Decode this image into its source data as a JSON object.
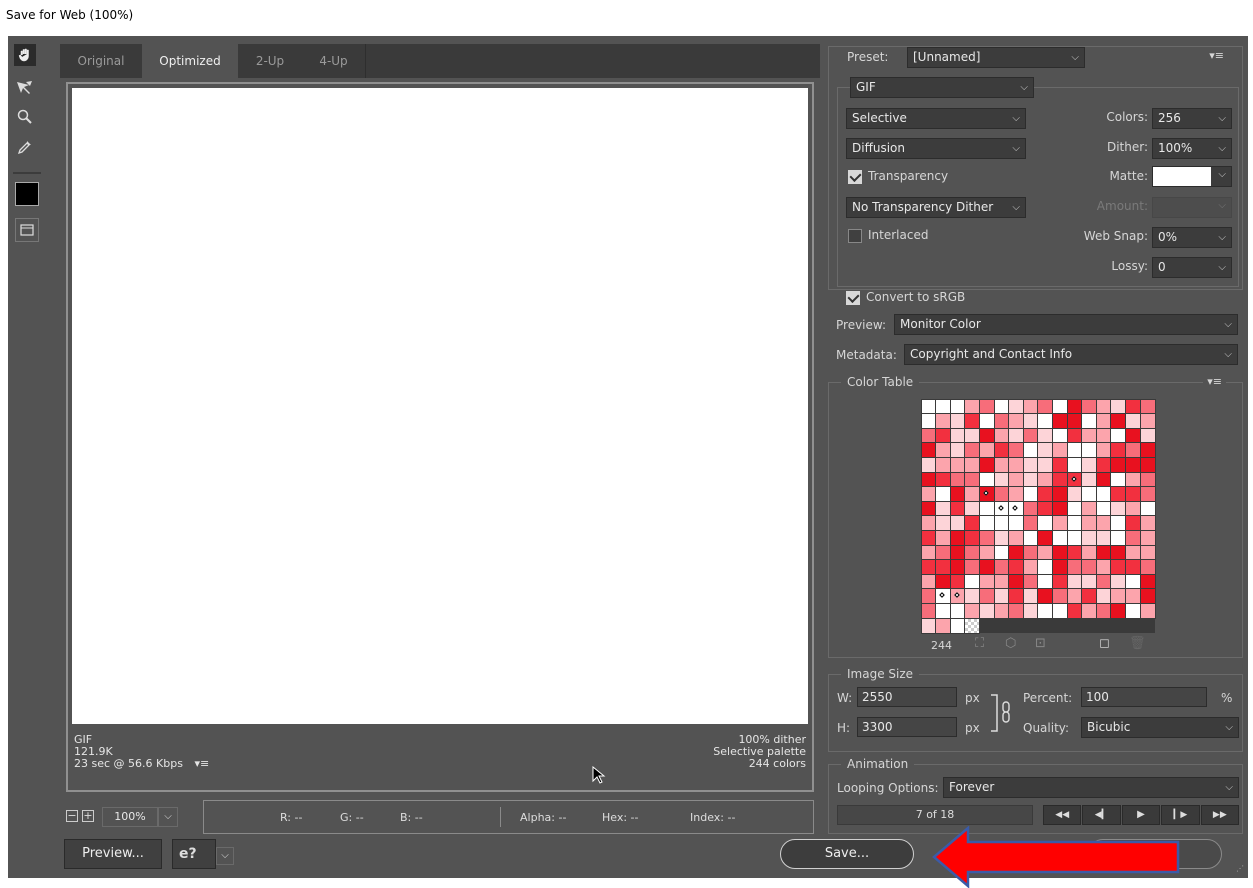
{
  "window_title": "Save for Web (100%)",
  "tabs": [
    "Original",
    "Optimized",
    "2-Up",
    "4-Up"
  ],
  "preview_info": {
    "format": "GIF",
    "size": "121.9K",
    "speed": "23 sec @ 56.6 Kbps",
    "dither": "100% dither",
    "palette": "Selective palette",
    "colors": "244 colors"
  },
  "status_bar": {
    "zoom": "100%",
    "r": "R: --",
    "g": "G: --",
    "b": "B: --",
    "alpha": "Alpha: --",
    "hex": "Hex: --",
    "index": "Index: --"
  },
  "buttons": {
    "preview": "Preview...",
    "save": "Save..."
  },
  "settings": {
    "preset_label": "Preset:",
    "preset_value": "[Unnamed]",
    "format": "GIF",
    "reduction": "Selective",
    "dither_algo": "Diffusion",
    "colors_label": "Colors:",
    "colors_value": "256",
    "dither_label": "Dither:",
    "dither_value": "100%",
    "transparency_label": "Transparency",
    "transparency_checked": true,
    "matte_label": "Matte:",
    "transparency_dither": "No Transparency Dither",
    "amount_label": "Amount:",
    "interlaced_label": "Interlaced",
    "interlaced_checked": false,
    "websnap_label": "Web Snap:",
    "websnap_value": "0%",
    "lossy_label": "Lossy:",
    "lossy_value": "0",
    "convert_srgb_label": "Convert to sRGB",
    "convert_srgb_checked": true,
    "preview_label": "Preview:",
    "preview_value": "Monitor Color",
    "metadata_label": "Metadata:",
    "metadata_value": "Copyright and Contact Info"
  },
  "color_table": {
    "title": "Color Table",
    "count": "244",
    "colors": [
      "#ffffff",
      "#fdd4d8",
      "#fca4ac",
      "#f76d7a",
      "#f2303f",
      "#e8111f"
    ]
  },
  "image_size": {
    "title": "Image Size",
    "w_label": "W:",
    "w_value": "2550",
    "h_label": "H:",
    "h_value": "3300",
    "unit": "px",
    "percent_label": "Percent:",
    "percent_value": "100",
    "percent_unit": "%",
    "quality_label": "Quality:",
    "quality_value": "Bicubic"
  },
  "animation": {
    "title": "Animation",
    "looping_label": "Looping Options:",
    "looping_value": "Forever",
    "frame_counter": "7 of 18"
  },
  "annotation_arrow_color": "#ff0000"
}
